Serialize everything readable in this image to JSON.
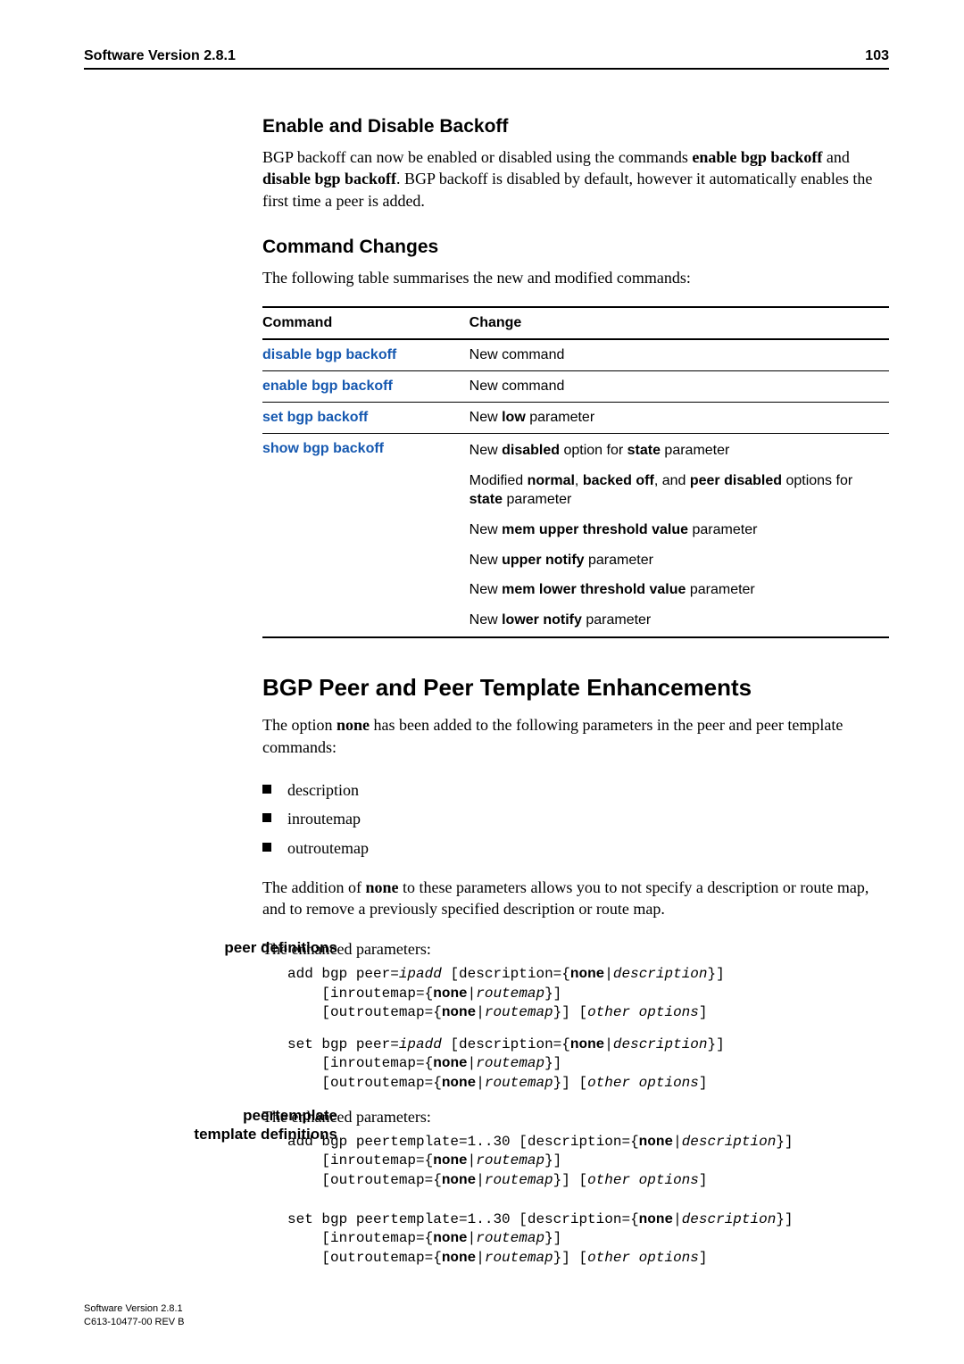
{
  "header": {
    "title": "Software Version 2.8.1",
    "page_number": "103"
  },
  "sec1": {
    "heading": "Enable and Disable Backoff",
    "p1_a": "BGP backoff can now be enabled or disabled using the commands ",
    "p1_b": "enable bgp backoff",
    "p1_c": " and ",
    "p1_d": "disable bgp backoff",
    "p1_e": ". BGP backoff is disabled by default, however it automatically enables the first time a peer is added."
  },
  "sec2": {
    "heading": "Command Changes",
    "intro": "The following table summarises the new and modified commands:",
    "th1": "Command",
    "th2": "Change",
    "rows": {
      "r0": {
        "cmd": "disable bgp backoff",
        "chg": "New command"
      },
      "r1": {
        "cmd": "enable bgp backoff",
        "chg": "New command"
      },
      "r2": {
        "cmd": "set bgp backoff",
        "chg_a": "New ",
        "chg_b": "low",
        "chg_c": " parameter"
      },
      "r3": {
        "cmd": "show bgp backoff",
        "l1_a": "New ",
        "l1_b": "disabled",
        "l1_c": " option for ",
        "l1_d": "state",
        "l1_e": " parameter",
        "l2_a": "Modified ",
        "l2_b": "normal",
        "l2_c": ", ",
        "l2_d": "backed off",
        "l2_e": ", and ",
        "l2_f": "peer disabled",
        "l2_g": " options for ",
        "l2_h": "state",
        "l2_i": " parameter",
        "l3_a": "New ",
        "l3_b": "mem upper threshold value",
        "l3_c": " parameter",
        "l4_a": "New ",
        "l4_b": "upper notify",
        "l4_c": " parameter",
        "l5_a": "New ",
        "l5_b": "mem lower threshold value",
        "l5_c": " parameter",
        "l6_a": "New ",
        "l6_b": "lower notify",
        "l6_c": " parameter"
      }
    }
  },
  "sec3": {
    "heading": "BGP Peer and Peer Template Enhancements",
    "p1_a": "The option ",
    "p1_b": "none",
    "p1_c": " has been added to the following parameters in the peer and peer template commands:",
    "bullets": {
      "b0": "description",
      "b1": "inroutemap",
      "b2": "outroutemap"
    },
    "p2_a": "The addition of ",
    "p2_b": "none",
    "p2_c": " to these parameters allows you to not specify a description or route map, and to remove a previously specified description or route map."
  },
  "peerdef": {
    "side": "peer definitions",
    "intro": "The enhanced parameters:",
    "c1": {
      "l1a": "add bgp peer=",
      "l1b": "ipadd",
      "l1c": " [description={",
      "l1d": "none",
      "l1e": "|",
      "l1f": "description",
      "l1g": "}]",
      "l2a": "[inroutemap={",
      "l2b": "none",
      "l2c": "|",
      "l2d": "routemap",
      "l2e": "}]",
      "l3a": "[outroutemap={",
      "l3b": "none",
      "l3c": "|",
      "l3d": "routemap",
      "l3e": "}] [",
      "l3f": "other options",
      "l3g": "]"
    },
    "c2": {
      "l1a": "set bgp peer=",
      "l1b": "ipadd",
      "l1c": " [description={",
      "l1d": "none",
      "l1e": "|",
      "l1f": "description",
      "l1g": "}]",
      "l2a": "[inroutemap={",
      "l2b": "none",
      "l2c": "|",
      "l2d": "routemap",
      "l2e": "}]",
      "l3a": "[outroutemap={",
      "l3b": "none",
      "l3c": "|",
      "l3d": "routemap",
      "l3e": "}] [",
      "l3f": "other options",
      "l3g": "]"
    }
  },
  "tmpldef": {
    "side_l1": "peertemplate",
    "side_l2": "template definitions",
    "intro": "The enhanced parameters:",
    "c1": {
      "l1a": "add bgp peertemplate=1..30 [description={",
      "l1b": "none",
      "l1c": "|",
      "l1d": "description",
      "l1e": "}]",
      "l2a": "[inroutemap={",
      "l2b": "none",
      "l2c": "|",
      "l2d": "routemap",
      "l2e": "}]",
      "l3a": "[outroutemap={",
      "l3b": "none",
      "l3c": "|",
      "l3d": "routemap",
      "l3e": "}] [",
      "l3f": "other options",
      "l3g": "]"
    },
    "c2": {
      "l1a": "set bgp peertemplate=1..30 [description={",
      "l1b": "none",
      "l1c": "|",
      "l1d": "description",
      "l1e": "}]",
      "l2a": "[inroutemap={",
      "l2b": "none",
      "l2c": "|",
      "l2d": "routemap",
      "l2e": "}]",
      "l3a": "[outroutemap={",
      "l3b": "none",
      "l3c": "|",
      "l3d": "routemap",
      "l3e": "}] [",
      "l3f": "other options",
      "l3g": "]"
    }
  },
  "footer": {
    "l1": "Software Version 2.8.1",
    "l2": "C613-10477-00 REV B"
  }
}
